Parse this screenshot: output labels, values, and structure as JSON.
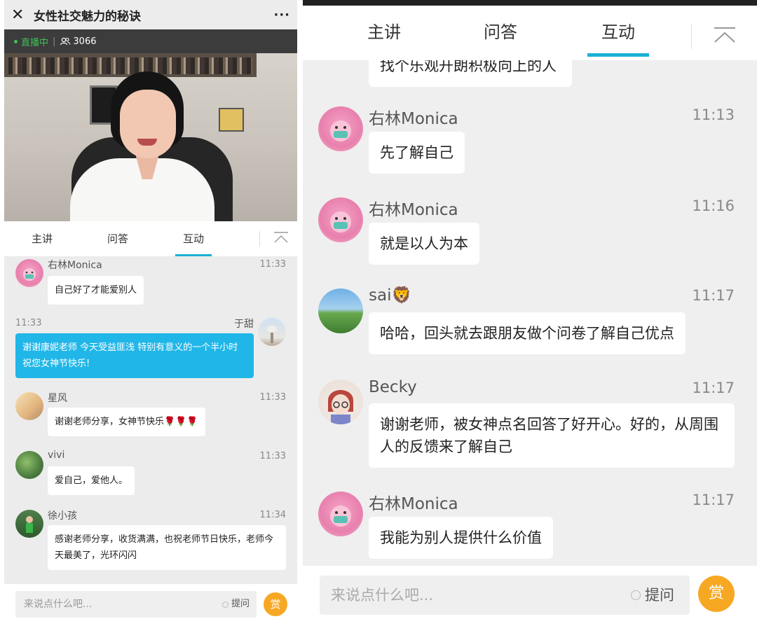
{
  "left": {
    "header": {
      "title": "女性社交魅力的秘诀",
      "close_icon": "close-icon",
      "more_label": "···"
    },
    "live": {
      "status": "直播中",
      "separator": "|",
      "viewers": "3066"
    },
    "tabs": [
      {
        "label": "主讲"
      },
      {
        "label": "问答"
      },
      {
        "label": "互动"
      }
    ],
    "messages": [
      {
        "name": "右林Monica",
        "time": "11:33",
        "text": "自己好了才能爱别人"
      },
      {
        "name": "于甜",
        "time": "11:33",
        "text": "谢谢康妮老师 今天受益匪浅 特别有意义的一个半小时 祝您女神节快乐!"
      },
      {
        "name": "星风",
        "time": "11:33",
        "text": "谢谢老师分享，女神节快乐🌹🌹🌹"
      },
      {
        "name": "vivi",
        "time": "11:33",
        "text": "爱自己，爱他人。"
      },
      {
        "name": "徐小孩",
        "time": "11:34",
        "text": "感谢老师分享，收货满满，也祝老师节日快乐，老师今天最美了，光环闪闪"
      }
    ],
    "input": {
      "placeholder": "来说点什么吧...",
      "ask_label": "提问",
      "reward_label": "赏"
    }
  },
  "right": {
    "tabs": [
      {
        "label": "主讲"
      },
      {
        "label": "问答"
      },
      {
        "label": "互动"
      }
    ],
    "partial_text": "找个乐观开朗积极向上的人",
    "messages": [
      {
        "name": "右林Monica",
        "time": "11:13",
        "text": "先了解自己"
      },
      {
        "name": "右林Monica",
        "time": "11:16",
        "text": "就是以人为本"
      },
      {
        "name": "sai🦁",
        "time": "11:17",
        "text": "哈哈，回头就去跟朋友做个问卷了解自己优点"
      },
      {
        "name": "Becky",
        "time": "11:17",
        "text": "谢谢老师，被女神点名回答了好开心。好的，从周围人的反馈来了解自己"
      },
      {
        "name": "右林Monica",
        "time": "11:17",
        "text": "我能为别人提供什么价值"
      }
    ],
    "input": {
      "placeholder": "来说点什么吧...",
      "ask_label": "提问",
      "reward_label": "赏"
    }
  },
  "colors": {
    "accent": "#1cb0d6",
    "bubble_blue": "#21b6e8",
    "reward": "#f7a823",
    "live_green": "#40c057"
  }
}
